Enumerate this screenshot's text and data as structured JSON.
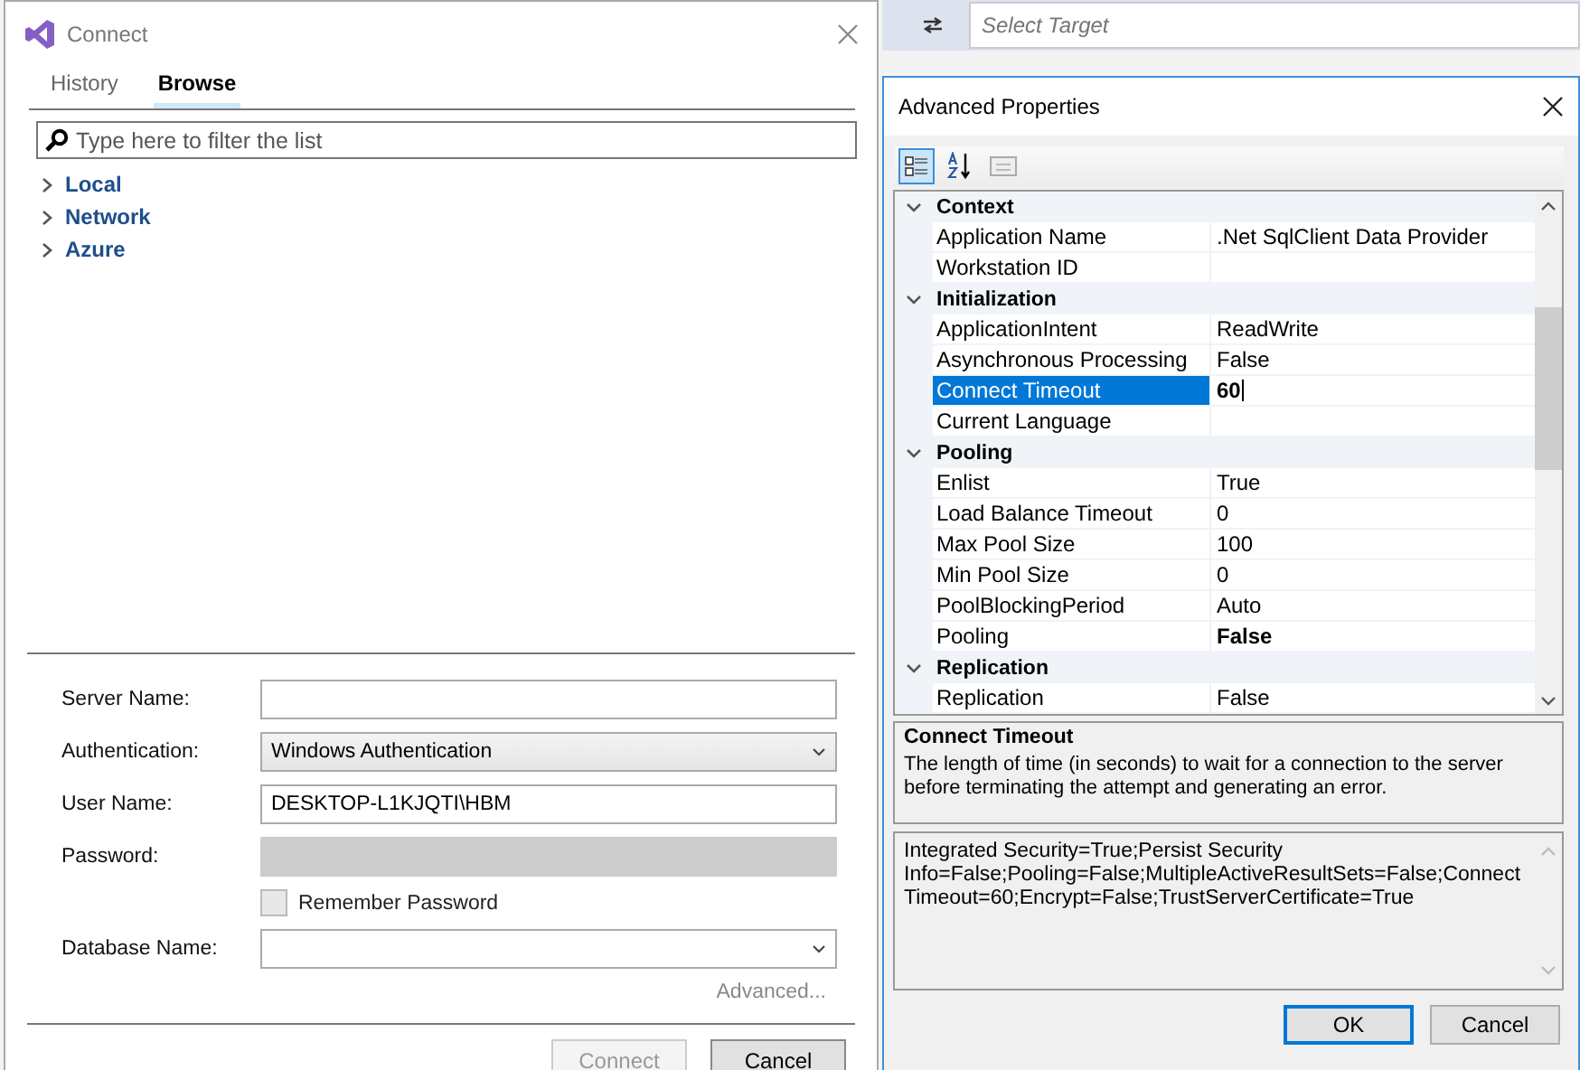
{
  "toolbar": {
    "target_placeholder": "Select Target"
  },
  "connect_dialog": {
    "title": "Connect",
    "tabs": [
      {
        "label": "History",
        "selected": false
      },
      {
        "label": "Browse",
        "selected": true
      }
    ],
    "filter": {
      "placeholder": "Type here to filter the list"
    },
    "tree": [
      {
        "label": "Local",
        "expanded": false
      },
      {
        "label": "Network",
        "expanded": false
      },
      {
        "label": "Azure",
        "expanded": false
      }
    ],
    "fields": [
      {
        "label": "Server Name:",
        "kind": "text"
      },
      {
        "label": "Authentication:",
        "kind": "combo",
        "value": "Windows Authentication"
      },
      {
        "label": "User Name:",
        "kind": "text",
        "value": "DESKTOP-L1KJQTI\\HBM"
      },
      {
        "label": "Password:",
        "kind": "text",
        "disabled": true
      },
      {
        "label": "Remember Password",
        "kind": "checkbox",
        "checked": false,
        "disabled": true
      },
      {
        "label": "Database Name:",
        "kind": "combo"
      }
    ],
    "advanced_link": "Advanced...",
    "buttons": [
      {
        "label": "Connect",
        "disabled": true
      },
      {
        "label": "Cancel",
        "disabled": false
      }
    ]
  },
  "advanced_dialog": {
    "title": "Advanced Properties",
    "categories": [
      {
        "name": "Context",
        "expanded": true,
        "rows": [
          {
            "name": "Application Name",
            "value": ".Net SqlClient Data Provider",
            "modified": false,
            "selected": false
          },
          {
            "name": "Workstation ID",
            "value": "",
            "modified": false,
            "selected": false
          }
        ]
      },
      {
        "name": "Initialization",
        "expanded": true,
        "rows": [
          {
            "name": "ApplicationIntent",
            "value": "ReadWrite",
            "modified": false,
            "selected": false
          },
          {
            "name": "Asynchronous Processing",
            "value": "False",
            "modified": false,
            "selected": false
          },
          {
            "name": "Connect Timeout",
            "value": "60",
            "modified": true,
            "selected": true
          },
          {
            "name": "Current Language",
            "value": "",
            "modified": false,
            "selected": false
          }
        ]
      },
      {
        "name": "Pooling",
        "expanded": true,
        "rows": [
          {
            "name": "Enlist",
            "value": "True",
            "modified": false,
            "selected": false
          },
          {
            "name": "Load Balance Timeout",
            "value": "0",
            "modified": false,
            "selected": false
          },
          {
            "name": "Max Pool Size",
            "value": "100",
            "modified": false,
            "selected": false
          },
          {
            "name": "Min Pool Size",
            "value": "0",
            "modified": false,
            "selected": false
          },
          {
            "name": "PoolBlockingPeriod",
            "value": "Auto",
            "modified": false,
            "selected": false
          },
          {
            "name": "Pooling",
            "value": "False",
            "modified": true,
            "selected": false
          }
        ]
      },
      {
        "name": "Replication",
        "expanded": true,
        "rows": [
          {
            "name": "Replication",
            "value": "False",
            "modified": false,
            "selected": false
          }
        ]
      }
    ],
    "description": {
      "title": "Connect Timeout",
      "text": "The length of time (in seconds) to wait for a connection to the server before terminating the attempt and generating an error."
    },
    "connection_string": "Integrated Security=True;Persist Security Info=False;Pooling=False;MultipleActiveResultSets=False;Connect Timeout=60;Encrypt=False;TrustServerCertificate=True",
    "buttons": [
      {
        "label": "OK",
        "default": true
      },
      {
        "label": "Cancel",
        "default": false
      }
    ]
  }
}
